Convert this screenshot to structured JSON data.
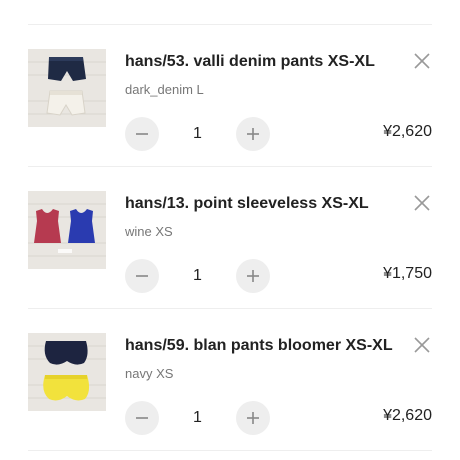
{
  "cart": {
    "items": [
      {
        "name": "hans/53. valli denim pants XS-XL",
        "variant": "dark_denim L",
        "quantity": "1",
        "price": "¥2,620",
        "image": "denim-shorts-photo"
      },
      {
        "name": "hans/13. point sleeveless XS-XL",
        "variant": "wine XS",
        "quantity": "1",
        "price": "¥1,750",
        "image": "sleeveless-tops-photo"
      },
      {
        "name": "hans/59. blan pants bloomer XS-XL",
        "variant": "navy XS",
        "quantity": "1",
        "price": "¥2,620",
        "image": "bloomer-pants-photo"
      }
    ]
  },
  "icons": {
    "remove": "close-icon",
    "decrease": "minus-icon",
    "increase": "plus-icon"
  },
  "colors": {
    "qty_button_bg": "#eeeeee",
    "divider": "#eeeeee",
    "variant_text": "#777777"
  }
}
